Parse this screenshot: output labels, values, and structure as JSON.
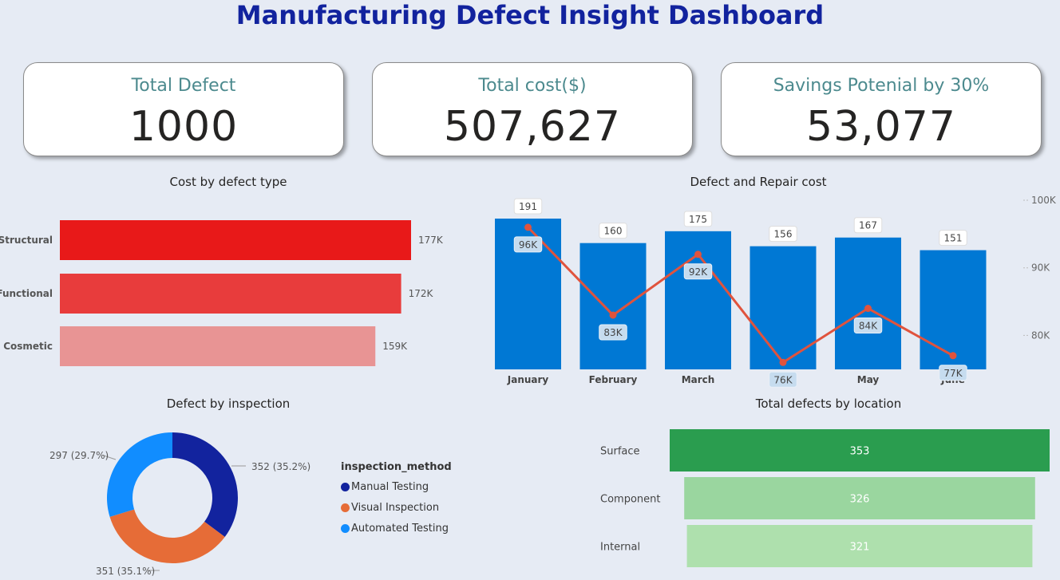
{
  "title": "Manufacturing Defect Insight Dashboard",
  "kpis": [
    {
      "label": "Total Defect",
      "value": "1000"
    },
    {
      "label": "Total cost($)",
      "value": "507,627"
    },
    {
      "label": "Savings Potenial by 30%",
      "value": "53,077"
    }
  ],
  "colors": {
    "title": "#12239e",
    "kpi_label": "#4c8a8e",
    "bar_blue": "#0078d4",
    "line_red": "#e0533d",
    "structural": "#e81919",
    "functional": "#e83c3c",
    "cosmetic": "#e89494",
    "manual": "#12239e",
    "visual": "#e66c37",
    "automated": "#118dff",
    "surface": "#2a9d4f",
    "component": "#9ad69f",
    "internal": "#aee0ad"
  },
  "chart_data": [
    {
      "type": "bar",
      "orientation": "horizontal",
      "title": "Cost by defect type",
      "categories": [
        "Structural",
        "Functional",
        "Cosmetic"
      ],
      "values": [
        177000,
        172000,
        159000
      ],
      "data_labels": [
        "177K",
        "172K",
        "159K"
      ],
      "colors": [
        "#e81919",
        "#e83c3c",
        "#e89494"
      ]
    },
    {
      "type": "bar",
      "title": "Defect and Repair cost",
      "categories": [
        "January",
        "February",
        "March",
        "April",
        "May",
        "June"
      ],
      "series": [
        {
          "type": "bar",
          "values": [
            191,
            160,
            175,
            156,
            167,
            151
          ],
          "data_labels": [
            "191",
            "160",
            "175",
            "156",
            "167",
            "151"
          ],
          "color": "#0078d4"
        },
        {
          "type": "line",
          "values": [
            96000,
            83000,
            92000,
            76000,
            84000,
            77000
          ],
          "data_labels": [
            "96K",
            "83K",
            "92K",
            "76K",
            "84K",
            "77K"
          ],
          "color": "#e0533d",
          "axis": "right"
        }
      ],
      "right_axis_ticks": [
        "100K",
        "90K",
        "80K"
      ],
      "right_axis_values": [
        100000,
        90000,
        80000
      ]
    },
    {
      "type": "pie",
      "donut": true,
      "title": "Defect by inspection",
      "legend_title": "inspection_method",
      "legend_position": "right",
      "categories": [
        "Manual Testing",
        "Visual Inspection",
        "Automated Testing"
      ],
      "values": [
        352,
        351,
        297
      ],
      "data_labels": [
        "352 (35.2%)",
        "351 (35.1%)",
        "297 (29.7%)"
      ],
      "colors": [
        "#12239e",
        "#e66c37",
        "#118dff"
      ]
    },
    {
      "type": "bar",
      "orientation": "horizontal",
      "style": "funnel",
      "title": "Total defects by location",
      "categories": [
        "Surface",
        "Component",
        "Internal"
      ],
      "values": [
        353,
        326,
        321
      ],
      "data_labels": [
        "353",
        "326",
        "321"
      ],
      "colors": [
        "#2a9d4f",
        "#9ad69f",
        "#aee0ad"
      ]
    }
  ]
}
